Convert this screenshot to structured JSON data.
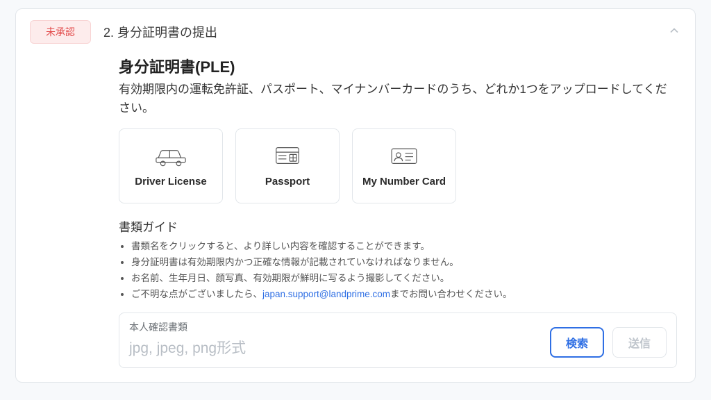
{
  "header": {
    "badge": "未承認",
    "step_title": "2. 身分証明書の提出"
  },
  "section": {
    "title": "身分証明書(PLE)",
    "lead": "有効期限内の運転免許証、パスポート、マイナンバーカードのうち、どれか1つをアップロードしてください。"
  },
  "doc_options": [
    {
      "key": "driver",
      "label": "Driver License"
    },
    {
      "key": "passport",
      "label": "Passport"
    },
    {
      "key": "mynumber",
      "label": "My Number Card"
    }
  ],
  "guide": {
    "heading": "書類ガイド",
    "items": [
      "書類名をクリックすると、より詳しい内容を確認することができます。",
      "身分証明書は有効期限内かつ正確な情報が記載されていなければなりません。",
      "お名前、生年月日、顔写真、有効期限が鮮明に写るよう撮影してください。"
    ],
    "contact_prefix": "ご不明な点がございましたら、",
    "contact_email": "japan.support@landprime.com",
    "contact_suffix": "までお問い合わせください。"
  },
  "upload": {
    "label": "本人確認書類",
    "placeholder": "jpg, jpeg, png形式",
    "browse": "検索",
    "submit": "送信"
  }
}
